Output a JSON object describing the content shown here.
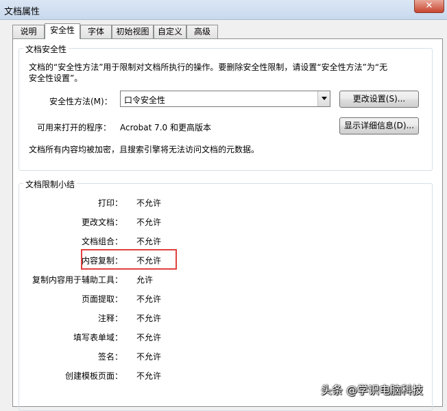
{
  "window": {
    "title": "文档属性",
    "close_glyph": "✕"
  },
  "tabs": [
    {
      "label": "说明"
    },
    {
      "label": "安全性",
      "active": true
    },
    {
      "label": "字体"
    },
    {
      "label": "初始视图"
    },
    {
      "label": "自定义"
    },
    {
      "label": "高级"
    }
  ],
  "security": {
    "group_title": "文档安全性",
    "description_line1": "文档的“安全性方法”用于限制对文档所执行的操作。要删除安全性限制，请设置“安全性方法”为“无",
    "description_line2": "安全性设置”。",
    "method_label": "安全性方法(M)：",
    "method_value": "口令安全性",
    "change_settings_button": "更改设置(S)...",
    "compat_label": "可用来打开的程序：",
    "compat_value": "Acrobat 7.0 和更高版本",
    "show_details_button": "显示详细信息(D)...",
    "encryption_note": "文档所有内容均被加密，且搜索引擎将无法访问文档的元数据。"
  },
  "restrictions": {
    "group_title": "文档限制小结",
    "items": [
      {
        "label": "打印：",
        "value": "不允许"
      },
      {
        "label": "更改文档：",
        "value": "不允许"
      },
      {
        "label": "文档组合：",
        "value": "不允许"
      },
      {
        "label": "内容复制：",
        "value": "不允许",
        "highlighted": true
      },
      {
        "label": "复制内容用于辅助工具：",
        "value": "允许"
      },
      {
        "label": "页面提取：",
        "value": "不允许"
      },
      {
        "label": "注释：",
        "value": "不允许"
      },
      {
        "label": "填写表单域：",
        "value": "不允许"
      },
      {
        "label": "签名：",
        "value": "不允许"
      },
      {
        "label": "创建模板页面：",
        "value": "不允许"
      }
    ]
  },
  "watermark": "头条 @学识电脑科技",
  "colors": {
    "highlight": "#e0403c",
    "close": "#c8452f"
  }
}
